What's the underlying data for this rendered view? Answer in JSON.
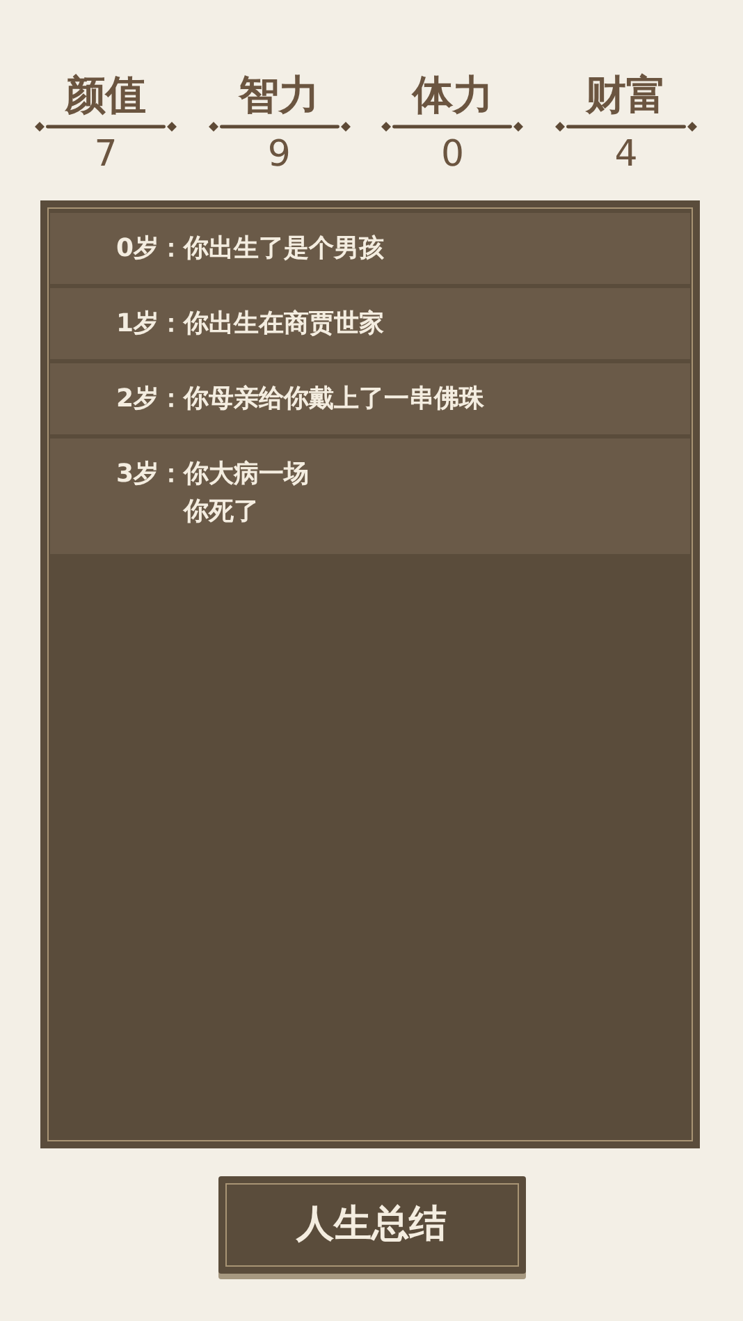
{
  "stats": [
    {
      "label": "颜值",
      "value": "7"
    },
    {
      "label": "智力",
      "value": "9"
    },
    {
      "label": "体力",
      "value": "0"
    },
    {
      "label": "财富",
      "value": "4"
    }
  ],
  "events": [
    {
      "age": "0岁：",
      "lines": [
        "你出生了是个男孩"
      ]
    },
    {
      "age": "1岁：",
      "lines": [
        "你出生在商贾世家"
      ]
    },
    {
      "age": "2岁：",
      "lines": [
        "你母亲给你戴上了一串佛珠"
      ]
    },
    {
      "age": "3岁：",
      "lines": [
        "你大病一场",
        "你死了"
      ]
    }
  ],
  "button": {
    "label": "人生总结"
  }
}
